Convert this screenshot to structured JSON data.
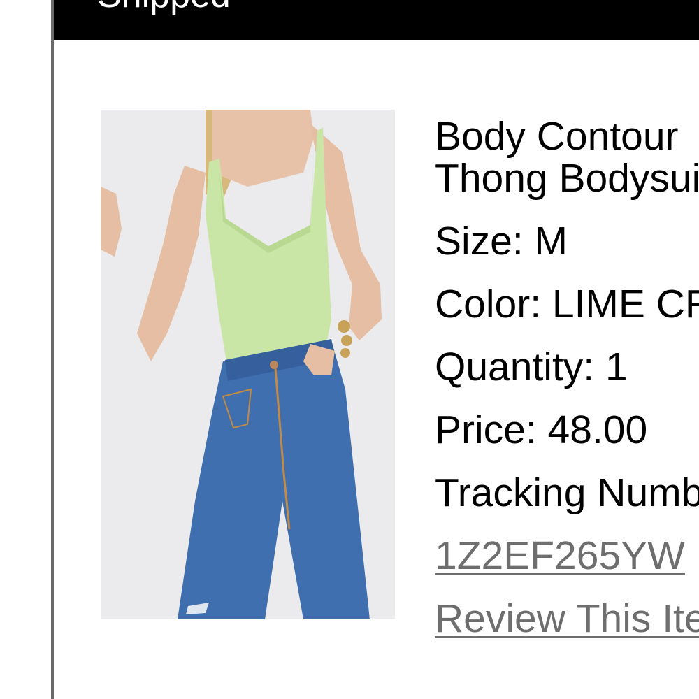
{
  "order_item": {
    "status": "Shipped",
    "product_name_line1": "Body Contour",
    "product_name_line2": "Thong Bodysuit",
    "size": "Size: M",
    "color": "Color: LIME CREAM",
    "quantity": "Quantity: 1",
    "price": "Price: 48.00",
    "tracking_label": "Tracking Number:",
    "tracking_number": "1Z2EF265YW",
    "review_link": "Review This Item"
  },
  "colors": {
    "status_bar": "#000000",
    "link": "#6e6e6e",
    "top": "#c9e6a6",
    "denim": "#3f6fae"
  }
}
